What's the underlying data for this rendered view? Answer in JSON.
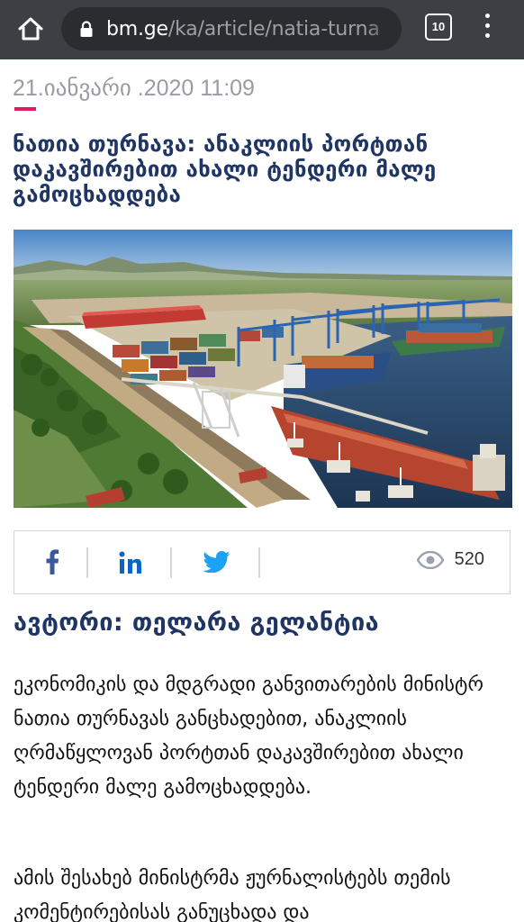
{
  "browser": {
    "url_domain": "bm.ge",
    "url_path": "/ka/article/natia-turna",
    "tab_count": "10",
    "icons": [
      "home-icon",
      "lock-icon",
      "tabs-icon",
      "more-vert-icon"
    ]
  },
  "article": {
    "date": "21.იანვარი .2020 11:09",
    "title": "ნათია თურნავა: ანაკლიის პორტთან დაკავშირებით ახალი ტენდერი მალე გამოცხადდება",
    "hero_image": "port-rendering",
    "share": {
      "icons": [
        "facebook-icon",
        "linkedin-icon",
        "twitter-icon",
        "eye-icon"
      ],
      "views": "520"
    },
    "author": "ავტორი: თელარა გელანტია",
    "paragraphs": [
      "ეკონომიკის და მდგრადი განვითარების მინისტრ ნათია თურნავას განცხადებით, ანაკლიის ღრმაწყლოვან პორტთან დაკავშირებით ახალი ტენდერი მალე გამოცხადდება.",
      "ამის შესახებ მინისტრმა ჟურნალისტებს თემის კომენტირებისას განუცხადა და"
    ]
  },
  "colors": {
    "topbar": "#3c3f43",
    "urlbar": "#2a2c2f",
    "title": "#1f3564",
    "accent": "#e8195a",
    "facebook": "#3b5998",
    "linkedin": "#0a66c2",
    "twitter": "#1da1f2",
    "date": "#9b9ba3"
  }
}
